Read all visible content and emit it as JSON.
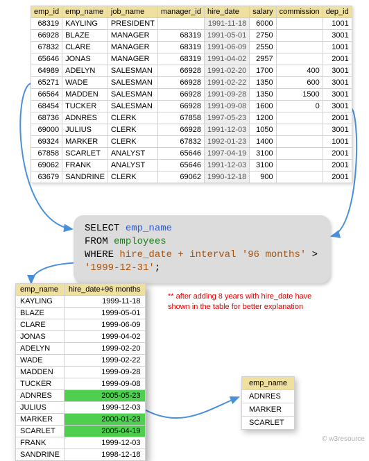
{
  "top_table": {
    "headers": [
      "emp_id",
      "emp_name",
      "job_name",
      "manager_id",
      "hire_date",
      "salary",
      "commission",
      "dep_id"
    ],
    "rows": [
      {
        "emp_id": "68319",
        "emp_name": "KAYLING",
        "job_name": "PRESIDENT",
        "manager_id": "",
        "hire_date": "1991-11-18",
        "salary": "6000",
        "commission": "",
        "dep_id": "1001"
      },
      {
        "emp_id": "66928",
        "emp_name": "BLAZE",
        "job_name": "MANAGER",
        "manager_id": "68319",
        "hire_date": "1991-05-01",
        "salary": "2750",
        "commission": "",
        "dep_id": "3001"
      },
      {
        "emp_id": "67832",
        "emp_name": "CLARE",
        "job_name": "MANAGER",
        "manager_id": "68319",
        "hire_date": "1991-06-09",
        "salary": "2550",
        "commission": "",
        "dep_id": "1001"
      },
      {
        "emp_id": "65646",
        "emp_name": "JONAS",
        "job_name": "MANAGER",
        "manager_id": "68319",
        "hire_date": "1991-04-02",
        "salary": "2957",
        "commission": "",
        "dep_id": "2001"
      },
      {
        "emp_id": "64989",
        "emp_name": "ADELYN",
        "job_name": "SALESMAN",
        "manager_id": "66928",
        "hire_date": "1991-02-20",
        "salary": "1700",
        "commission": "400",
        "dep_id": "3001"
      },
      {
        "emp_id": "65271",
        "emp_name": "WADE",
        "job_name": "SALESMAN",
        "manager_id": "66928",
        "hire_date": "1991-02-22",
        "salary": "1350",
        "commission": "600",
        "dep_id": "3001"
      },
      {
        "emp_id": "66564",
        "emp_name": "MADDEN",
        "job_name": "SALESMAN",
        "manager_id": "66928",
        "hire_date": "1991-09-28",
        "salary": "1350",
        "commission": "1500",
        "dep_id": "3001"
      },
      {
        "emp_id": "68454",
        "emp_name": "TUCKER",
        "job_name": "SALESMAN",
        "manager_id": "66928",
        "hire_date": "1991-09-08",
        "salary": "1600",
        "commission": "0",
        "dep_id": "3001"
      },
      {
        "emp_id": "68736",
        "emp_name": "ADNRES",
        "job_name": "CLERK",
        "manager_id": "67858",
        "hire_date": "1997-05-23",
        "salary": "1200",
        "commission": "",
        "dep_id": "2001"
      },
      {
        "emp_id": "69000",
        "emp_name": "JULIUS",
        "job_name": "CLERK",
        "manager_id": "66928",
        "hire_date": "1991-12-03",
        "salary": "1050",
        "commission": "",
        "dep_id": "3001"
      },
      {
        "emp_id": "69324",
        "emp_name": "MARKER",
        "job_name": "CLERK",
        "manager_id": "67832",
        "hire_date": "1992-01-23",
        "salary": "1400",
        "commission": "",
        "dep_id": "1001"
      },
      {
        "emp_id": "67858",
        "emp_name": "SCARLET",
        "job_name": "ANALYST",
        "manager_id": "65646",
        "hire_date": "1997-04-19",
        "salary": "3100",
        "commission": "",
        "dep_id": "2001"
      },
      {
        "emp_id": "69062",
        "emp_name": "FRANK",
        "job_name": "ANALYST",
        "manager_id": "65646",
        "hire_date": "1991-12-03",
        "salary": "3100",
        "commission": "",
        "dep_id": "2001"
      },
      {
        "emp_id": "63679",
        "emp_name": "SANDRINE",
        "job_name": "CLERK",
        "manager_id": "69062",
        "hire_date": "1990-12-18",
        "salary": "900",
        "commission": "",
        "dep_id": "2001"
      }
    ]
  },
  "sql": {
    "kw_select": "SELECT",
    "col_emp_name": "emp_name",
    "kw_from": "FROM",
    "tbl_employees": "employees",
    "kw_where": "WHERE",
    "expr_hire": "hire_date + interval '96 months'",
    "op_gt": ">",
    "lit_date": "'1999-12-31'",
    "semi": ";"
  },
  "mid_table": {
    "headers": [
      "emp_name",
      "hire_date+96 months"
    ],
    "rows": [
      {
        "emp_name": "KAYLING",
        "date": "1999-11-18",
        "hl": false
      },
      {
        "emp_name": "BLAZE",
        "date": "1999-05-01",
        "hl": false
      },
      {
        "emp_name": "CLARE",
        "date": "1999-06-09",
        "hl": false
      },
      {
        "emp_name": "JONAS",
        "date": "1999-04-02",
        "hl": false
      },
      {
        "emp_name": "ADELYN",
        "date": "1999-02-20",
        "hl": false
      },
      {
        "emp_name": "WADE",
        "date": "1999-02-22",
        "hl": false
      },
      {
        "emp_name": "MADDEN",
        "date": "1999-09-28",
        "hl": false
      },
      {
        "emp_name": "TUCKER",
        "date": "1999-09-08",
        "hl": false
      },
      {
        "emp_name": "ADNRES",
        "date": "2005-05-23",
        "hl": true
      },
      {
        "emp_name": "JULIUS",
        "date": "1999-12-03",
        "hl": false
      },
      {
        "emp_name": "MARKER",
        "date": "2000-01-23",
        "hl": true
      },
      {
        "emp_name": "SCARLET",
        "date": "2005-04-19",
        "hl": true
      },
      {
        "emp_name": "FRANK",
        "date": "1999-12-03",
        "hl": false
      },
      {
        "emp_name": "SANDRINE",
        "date": "1998-12-18",
        "hl": false
      }
    ]
  },
  "res_table": {
    "header": "emp_name",
    "rows": [
      "ADNRES",
      "MARKER",
      "SCARLET"
    ]
  },
  "annotation": "** after adding 8 years with hire_date have shown in the table for better explanation",
  "footer": "© w3resource"
}
